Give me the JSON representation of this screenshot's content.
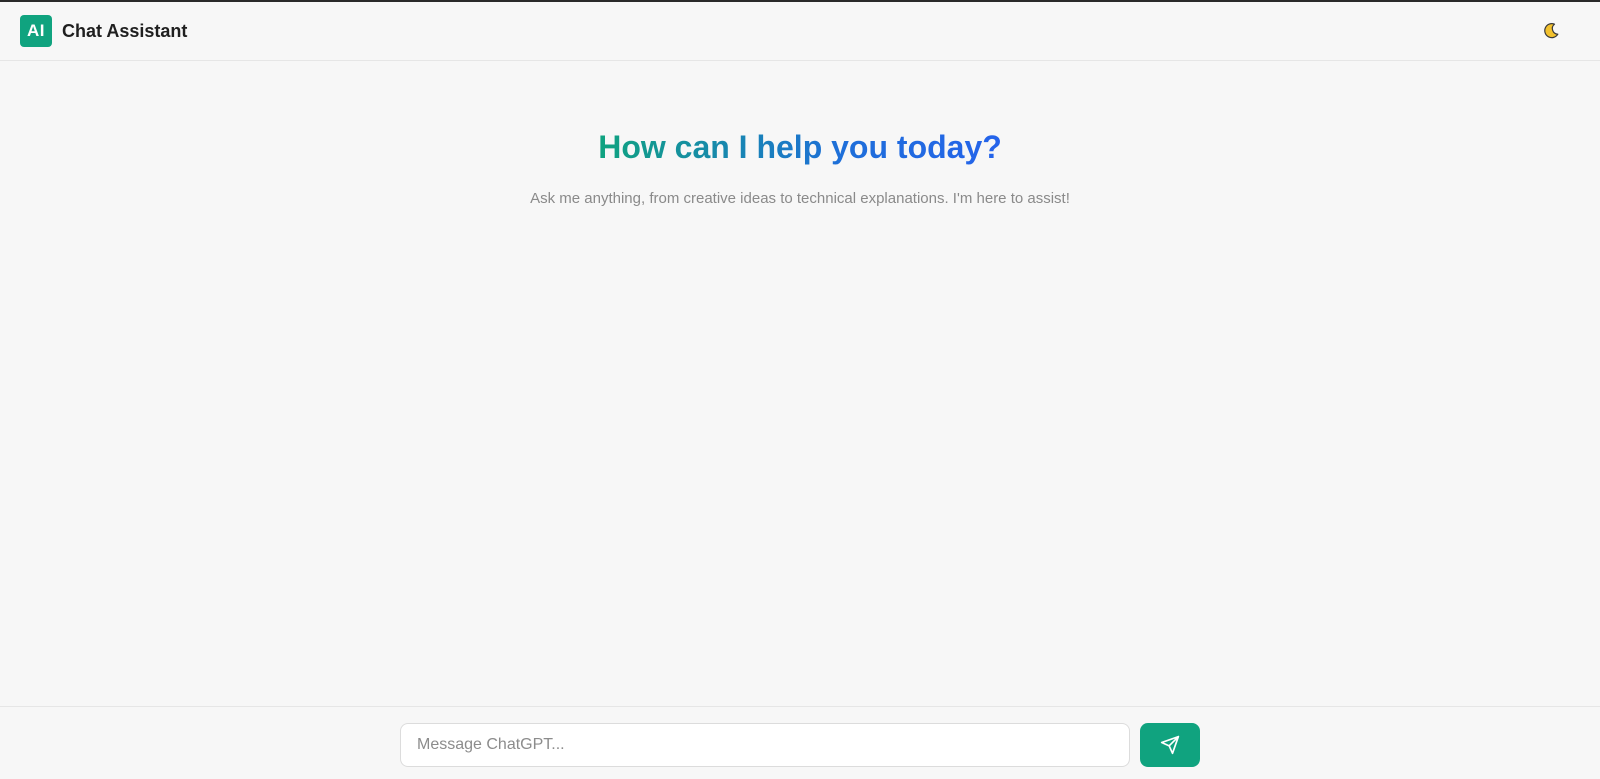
{
  "header": {
    "logo_text": "AI",
    "title": "Chat Assistant",
    "theme_toggle_icon": "moon-icon"
  },
  "welcome": {
    "title": "How can I help you today?",
    "subtitle": "Ask me anything, from creative ideas to technical explanations. I'm here to assist!"
  },
  "composer": {
    "placeholder": "Message ChatGPT...",
    "value": "",
    "send_icon": "send-icon"
  },
  "colors": {
    "accent": "#10a37f",
    "gradient_end": "#2563eb",
    "background": "#f7f7f7"
  }
}
